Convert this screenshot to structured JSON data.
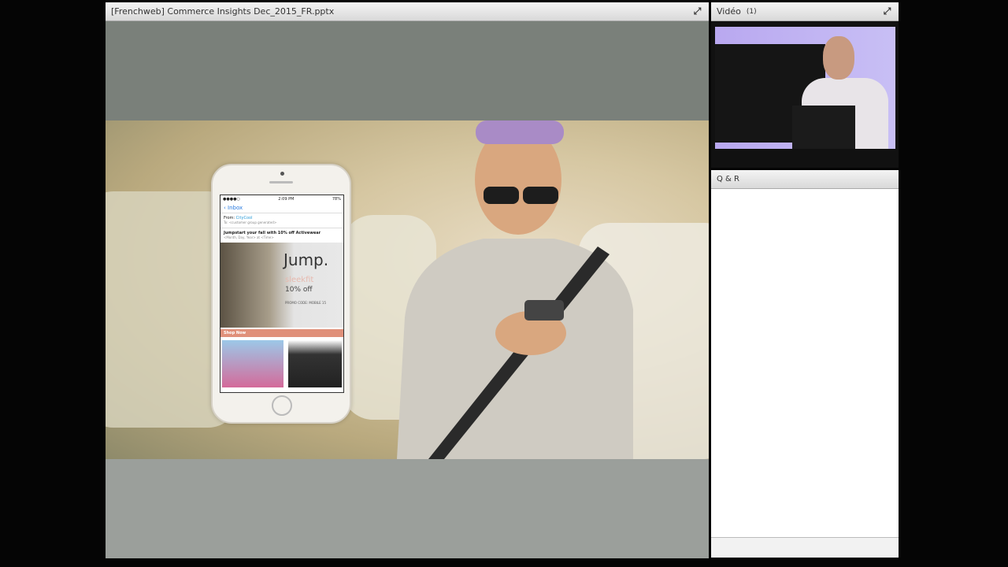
{
  "share_pod": {
    "title": "[Frenchweb] Commerce Insights Dec_2015_FR.pptx",
    "maximize_icon": "expand-icon"
  },
  "slide": {
    "phone": {
      "status_time": "2:09 PM",
      "battery": "78%",
      "back": "Inbox",
      "from_label": "From:",
      "from_name": "CityCool",
      "to": "To: <customer group generated>",
      "subject": "Jumpstart your fall with 10% off Activewear",
      "date": "<Month, Day, Year> at <Time>",
      "headline": "Jump.",
      "brand": "sleekfit",
      "offer": "10% off",
      "promo": "PROMO CODE: MOBILE 15",
      "cta": "Shop Now"
    }
  },
  "video_pod": {
    "title": "Vidéo",
    "count": "(1)"
  },
  "qa_pod": {
    "title": "Q & R"
  }
}
